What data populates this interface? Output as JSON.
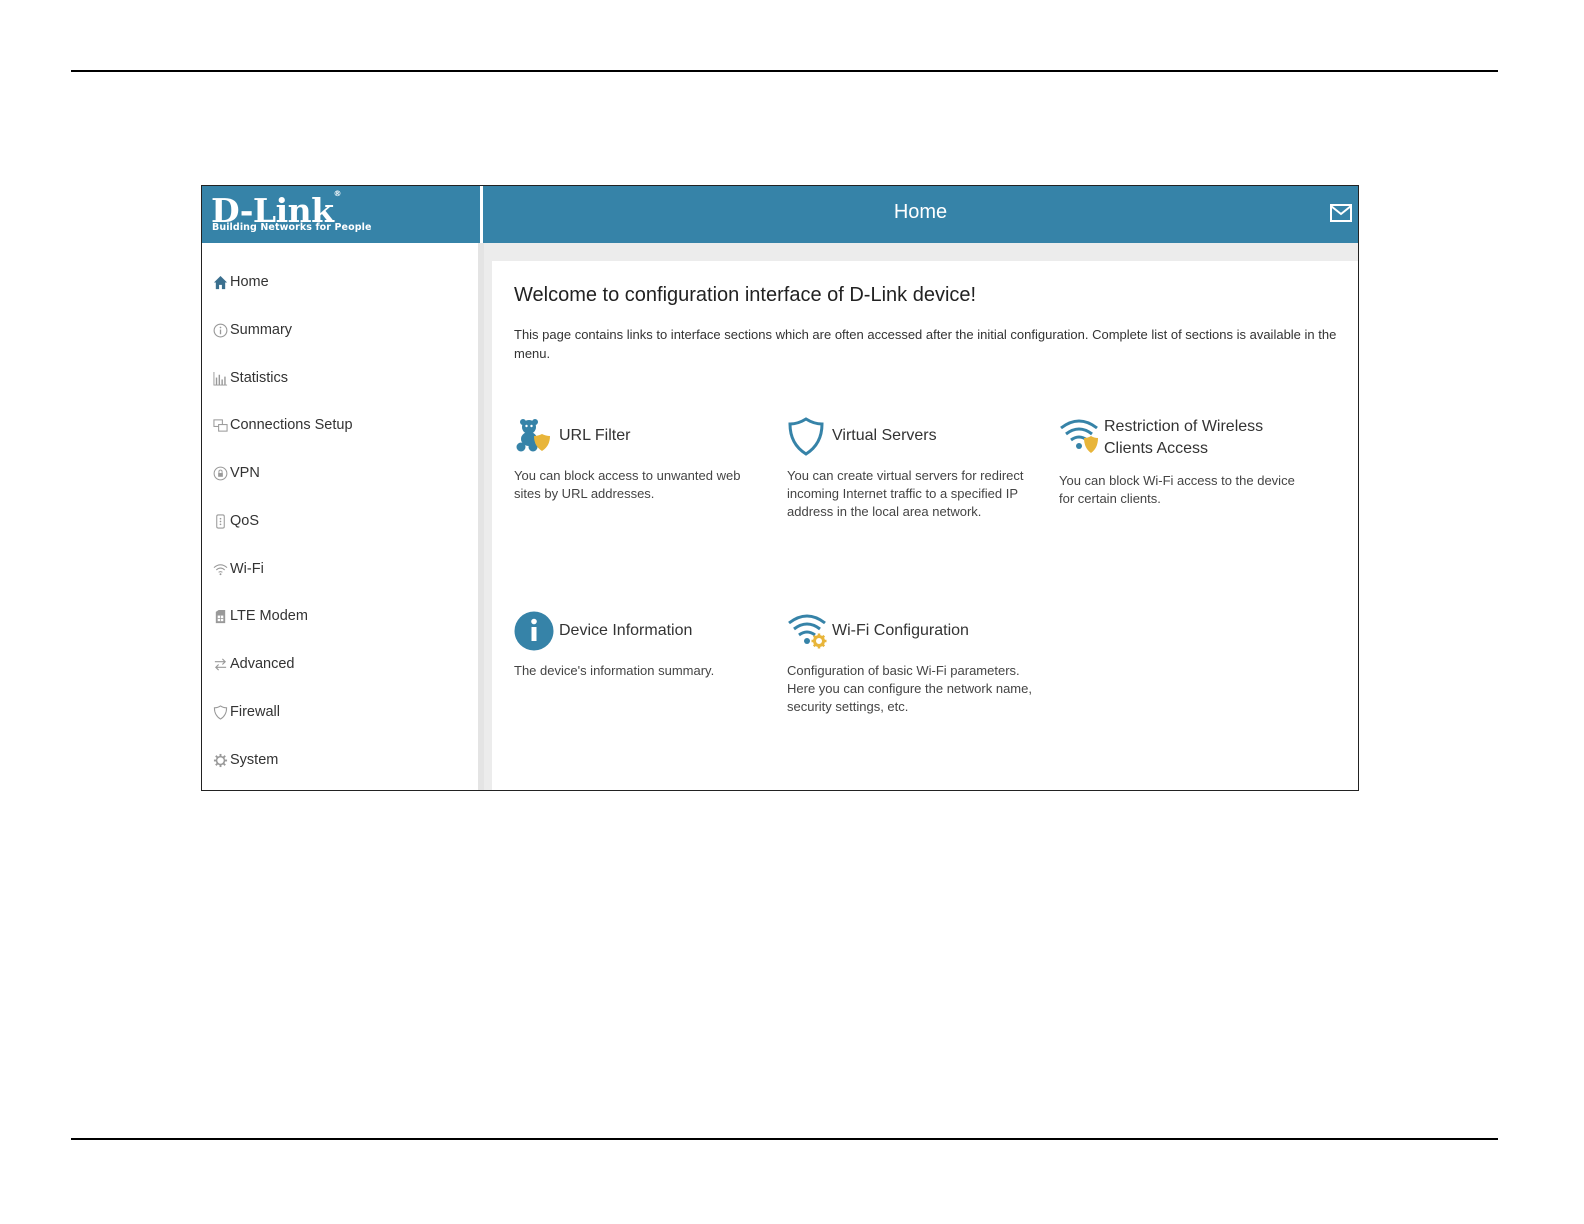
{
  "brand": {
    "logo": "D-Link",
    "tagline": "Building Networks for People"
  },
  "header": {
    "title": "Home",
    "mail_icon": "mail-icon"
  },
  "sidebar": {
    "items": [
      {
        "label": "Home",
        "icon": "home-icon"
      },
      {
        "label": "Summary",
        "icon": "info-icon"
      },
      {
        "label": "Statistics",
        "icon": "bar-chart-icon"
      },
      {
        "label": "Connections Setup",
        "icon": "connections-icon"
      },
      {
        "label": "VPN",
        "icon": "vpn-icon"
      },
      {
        "label": "QoS",
        "icon": "qos-icon"
      },
      {
        "label": "Wi-Fi",
        "icon": "wifi-icon"
      },
      {
        "label": "LTE Modem",
        "icon": "sim-card-icon"
      },
      {
        "label": "Advanced",
        "icon": "arrows-icon"
      },
      {
        "label": "Firewall",
        "icon": "shield-icon"
      },
      {
        "label": "System",
        "icon": "gear-icon"
      }
    ]
  },
  "main": {
    "welcome": "Welcome to configuration interface of D-Link device!",
    "intro": "This page contains links to interface sections which are often accessed after the initial configuration. Complete list of sections is available in the menu.",
    "tiles": [
      {
        "title": "URL Filter",
        "desc": "You can block access to unwanted web sites by URL addresses.",
        "icon": "url-filter-icon"
      },
      {
        "title": "Virtual Servers",
        "desc": "You can create virtual servers for redirect incoming Internet traffic to a specified IP address in the local area network.",
        "icon": "shield-icon"
      },
      {
        "title": "Restriction of Wireless Clients Access",
        "desc": "You can block Wi-Fi access to the device for certain clients.",
        "icon": "wifi-shield-icon"
      },
      {
        "title": "Device Information",
        "desc": "The device's information summary.",
        "icon": "info-circle-icon"
      },
      {
        "title": "Wi-Fi Configuration",
        "desc": "Configuration of basic Wi-Fi parameters. Here you can configure the network name, security settings, etc.",
        "icon": "wifi-gear-icon"
      }
    ]
  },
  "colors": {
    "brand_blue": "#3683a8",
    "accent_yellow": "#e8b53a"
  }
}
